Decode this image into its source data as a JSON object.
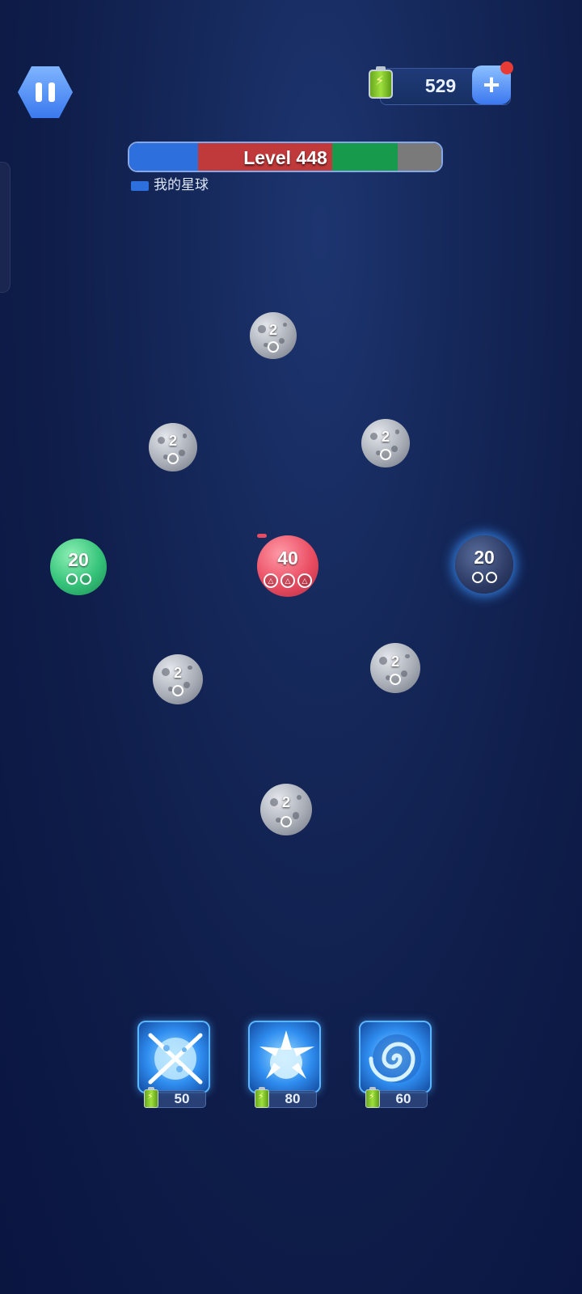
{
  "hud": {
    "energy_value": "529",
    "level_title": "Level 448",
    "legend_label": "我的星球",
    "level_segments": [
      {
        "color": "#2d6fdc",
        "fraction": 0.22
      },
      {
        "color": "#c0393b",
        "fraction": 0.43
      },
      {
        "color": "#179a4b",
        "fraction": 0.21
      },
      {
        "color": "#7a7a7a",
        "fraction": 0.14
      }
    ]
  },
  "planets": [
    {
      "kind": "moon",
      "count": "2",
      "slots": 1
    },
    {
      "kind": "moon",
      "count": "2",
      "slots": 1
    },
    {
      "kind": "moon",
      "count": "2",
      "slots": 1
    },
    {
      "kind": "green",
      "count": "20",
      "slots": 2
    },
    {
      "kind": "red",
      "count": "40",
      "slots": 3
    },
    {
      "kind": "dark",
      "count": "20",
      "slots": 2
    },
    {
      "kind": "moon",
      "count": "2",
      "slots": 1
    },
    {
      "kind": "moon",
      "count": "2",
      "slots": 1
    },
    {
      "kind": "moon",
      "count": "2",
      "slots": 1
    }
  ],
  "powerups": [
    {
      "icon": "chain-lock-icon",
      "price": "50"
    },
    {
      "icon": "shatter-burst-icon",
      "price": "80"
    },
    {
      "icon": "vortex-icon",
      "price": "60"
    }
  ]
}
